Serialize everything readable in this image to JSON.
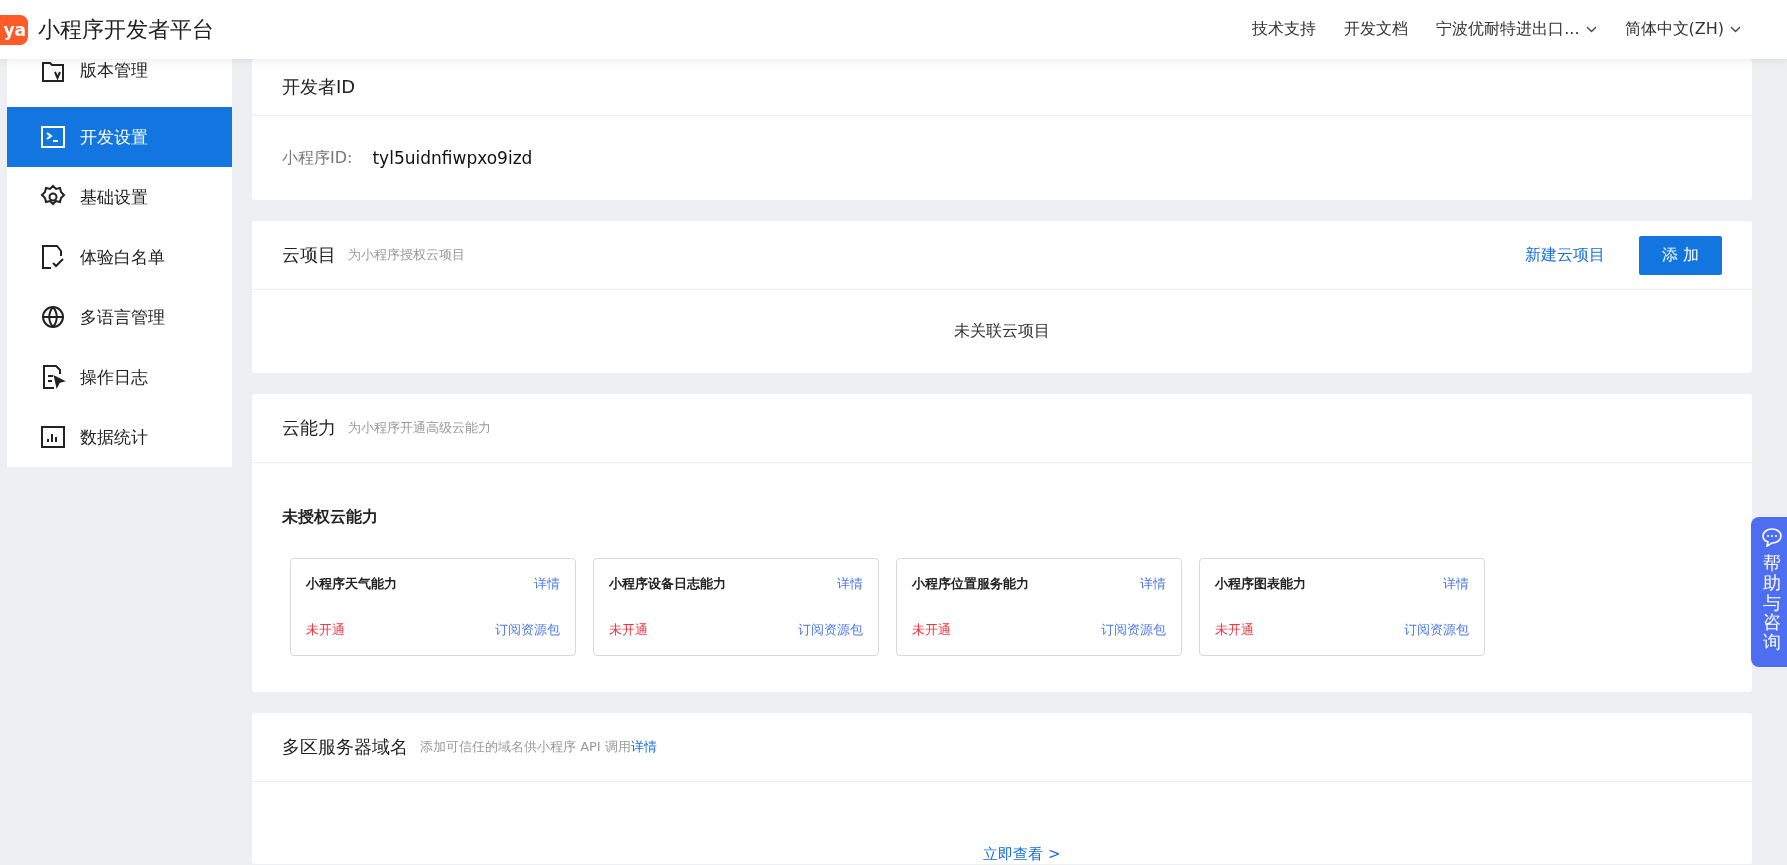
{
  "header": {
    "logo": "ya",
    "title": "小程序开发者平台",
    "nav": [
      {
        "label": "技术支持",
        "dropdown": false
      },
      {
        "label": "开发文档",
        "dropdown": false
      },
      {
        "label": "宁波优耐特进出口...",
        "dropdown": true
      },
      {
        "label": "简体中文(ZH)",
        "dropdown": true
      }
    ]
  },
  "sidebar": {
    "items": [
      {
        "label": "版本管理",
        "selected": false
      },
      {
        "label": "开发设置",
        "selected": true
      },
      {
        "label": "基础设置",
        "selected": false
      },
      {
        "label": "体验白名单",
        "selected": false
      },
      {
        "label": "多语言管理",
        "selected": false
      },
      {
        "label": "操作日志",
        "selected": false
      },
      {
        "label": "数据统计",
        "selected": false
      }
    ]
  },
  "developer_id": {
    "title": "开发者ID",
    "label": "小程序ID:",
    "value": "tyl5uidnfiwpxo9izd"
  },
  "cloud_projects": {
    "title": "云项目",
    "subtitle": "为小程序授权云项目",
    "link": "新建云项目",
    "button": "添 加",
    "empty": "未关联云项目"
  },
  "cloud_capabilities": {
    "title": "云能力",
    "subtitle": "为小程序开通高级云能力",
    "group_title": "未授权云能力",
    "items": [
      {
        "name": "小程序天气能力",
        "details": "详情",
        "status": "未开通",
        "action": "订阅资源包"
      },
      {
        "name": "小程序设备日志能力",
        "details": "详情",
        "status": "未开通",
        "action": "订阅资源包"
      },
      {
        "name": "小程序位置服务能力",
        "details": "详情",
        "status": "未开通",
        "action": "订阅资源包"
      },
      {
        "name": "小程序图表能力",
        "details": "详情",
        "status": "未开通",
        "action": "订阅资源包"
      }
    ]
  },
  "server_domains": {
    "title": "多区服务器域名",
    "subtitle": "添加可信任的域名供小程序 API 调用",
    "link": "详情",
    "view_link": "立即查看 >"
  },
  "help_button": {
    "label": "帮助与咨询"
  }
}
